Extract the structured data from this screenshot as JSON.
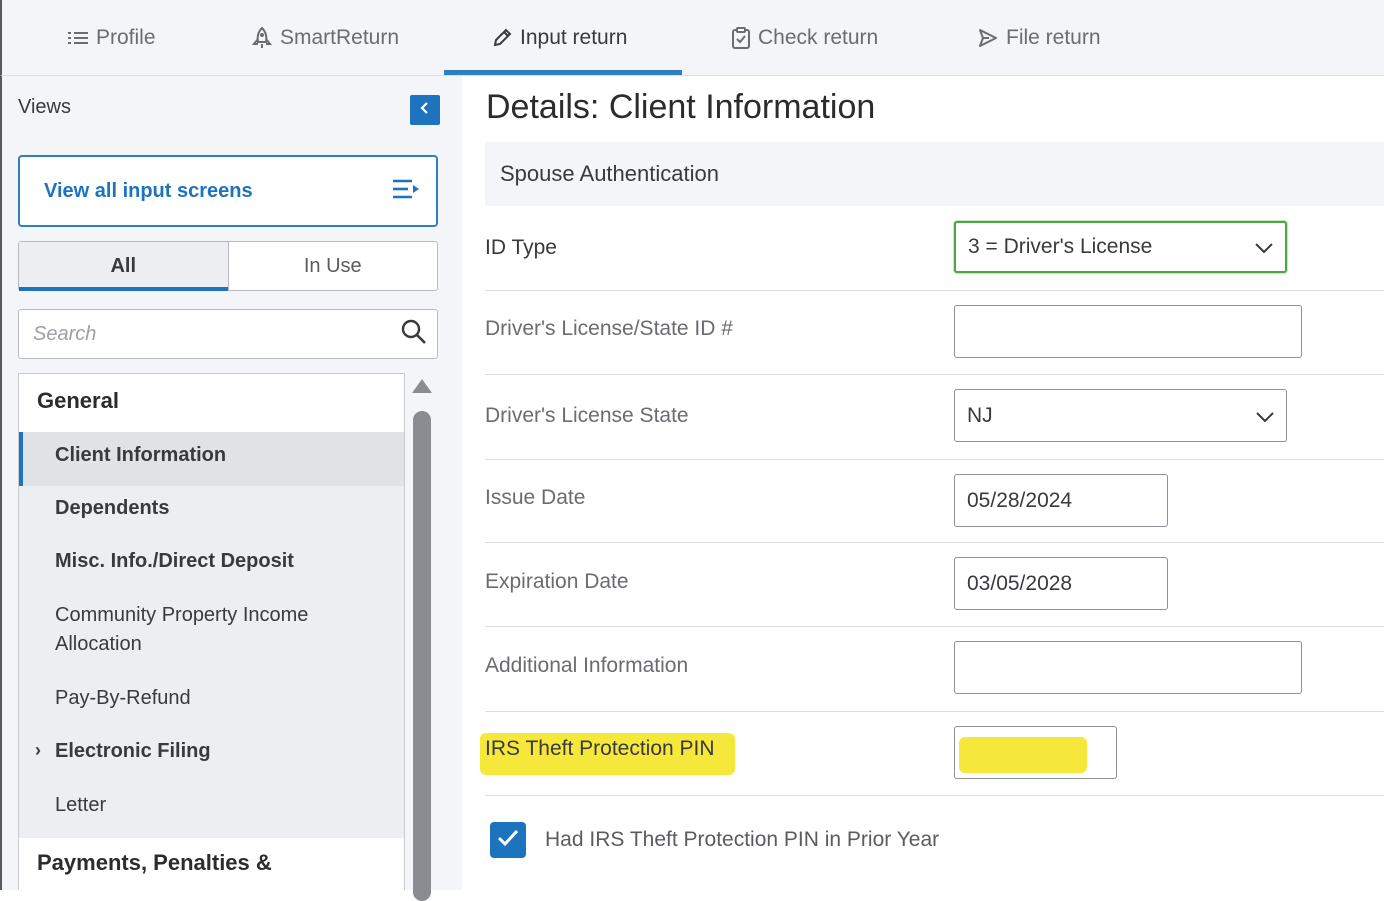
{
  "tabs": [
    {
      "label": "Profile",
      "icon": "list-icon"
    },
    {
      "label": "SmartReturn",
      "icon": "rocket-icon"
    },
    {
      "label": "Input return",
      "icon": "pencil-icon"
    },
    {
      "label": "Check return",
      "icon": "clipboard-check-icon"
    },
    {
      "label": "File return",
      "icon": "send-icon"
    }
  ],
  "sidebar": {
    "views_label": "Views",
    "view_all_label": "View all input screens",
    "segments": [
      "All",
      "In Use"
    ],
    "search_placeholder": "Search",
    "groups": [
      {
        "label": "General",
        "items": [
          "Client Information",
          "Dependents",
          "Misc. Info./Direct Deposit",
          "Community Property Income",
          "Allocation",
          "Pay-By-Refund",
          "Electronic Filing",
          "Letter"
        ]
      },
      {
        "label": "Payments, Penalties &"
      }
    ]
  },
  "main": {
    "title": "Details: Client Information",
    "section": "Spouse Authentication",
    "fields": {
      "id_type": {
        "label": "ID Type",
        "value": "3 = Driver's License"
      },
      "license_number": {
        "label": "Driver's License/State ID #",
        "value": ""
      },
      "license_state": {
        "label": "Driver's License State",
        "value": "NJ"
      },
      "issue_date": {
        "label": "Issue Date",
        "value": "05/28/2024"
      },
      "expiration_date": {
        "label": "Expiration Date",
        "value": "03/05/2028"
      },
      "additional_info": {
        "label": "Additional Information",
        "value": ""
      },
      "theft_pin": {
        "label": "IRS Theft Protection PIN",
        "value": ""
      }
    },
    "checkbox_label": "Had IRS Theft Protection PIN in Prior Year",
    "checkbox_checked": true
  },
  "colors": {
    "accent": "#1e73be",
    "highlight": "#f5e83b",
    "valid_border": "#4aa83e"
  }
}
